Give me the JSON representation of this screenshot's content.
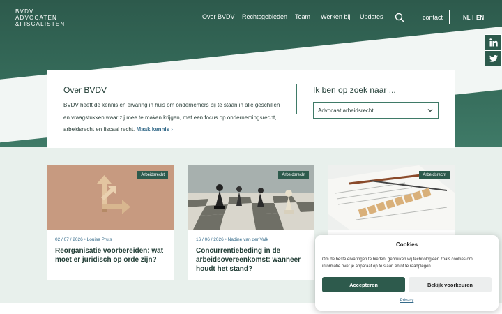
{
  "logo": {
    "line1": "BVDV",
    "line2": "ADVOCATEN",
    "line3": "&FISCALISTEN"
  },
  "nav": {
    "items": [
      {
        "label": "Over BVDV"
      },
      {
        "label": "Rechtsgebieden"
      },
      {
        "label": "Team"
      },
      {
        "label": "Werken bij"
      },
      {
        "label": "Updates"
      }
    ],
    "contact": "contact",
    "lang_nl": "NL",
    "lang_sep": "|",
    "lang_en": "EN"
  },
  "about": {
    "title": "Over BVDV",
    "text": "BVDV heeft de kennis en ervaring in huis om ondernemers bij te staan in alle geschillen en vraagstukken waar zij mee te maken krijgen, met een focus op ondernemingsrecht, arbeidsrecht en fiscaal recht.",
    "link": "Maak kennis ›"
  },
  "search": {
    "title": "Ik ben op zoek naar ...",
    "selected": "Advocaat arbeidsrecht"
  },
  "news": [
    {
      "badge": "Arbeidsrecht",
      "date": "02 / 07 / 2026",
      "author": "Louisa Pruis",
      "title": "Reorganisatie voorbereiden: wat moet er juridisch op orde zijn?"
    },
    {
      "badge": "Arbeidsrecht",
      "date": "16 / 06 / 2026",
      "author": "Nadine van der Valk",
      "title": "Concurrentiebeding in de arbeidsovereenkomst: wanneer houdt het stand?"
    },
    {
      "badge": "Arbeidsrecht",
      "date": "",
      "author": "",
      "title": ""
    }
  ],
  "meta_sep": "•",
  "cookie": {
    "title": "Cookies",
    "text": "Om de beste ervaringen te bieden, gebruiken wij technologieën zoals cookies om informatie over je apparaat op te slaan en/of te raadplegen.",
    "accept": "Accepteren",
    "preferences": "Bekijk voorkeuren",
    "privacy": "Privacy"
  },
  "colors": {
    "primary": "#2d5a4c",
    "accent": "#356b8a",
    "background": "#e8f0ec"
  }
}
